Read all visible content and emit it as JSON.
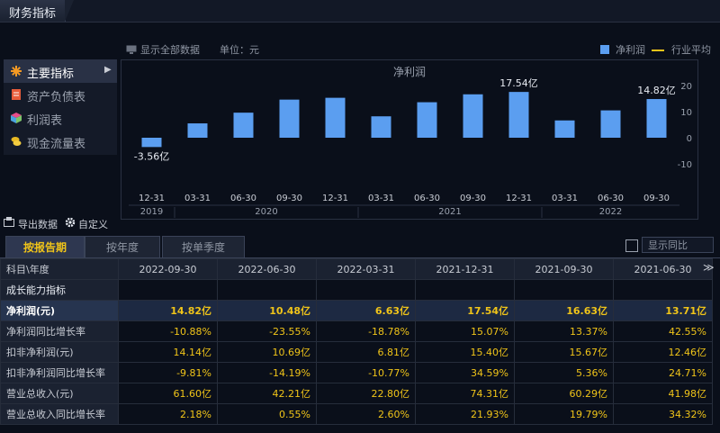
{
  "window": {
    "title": "财务指标"
  },
  "toolbar": {
    "show_all": "显示全部数据",
    "unit": "单位：元",
    "legend_net": "净利润",
    "legend_avg": "行业平均"
  },
  "menu": {
    "items": [
      {
        "label": "主要指标",
        "icon": "asterisk-icon",
        "color": "#f59a23"
      },
      {
        "label": "资产负债表",
        "icon": "document-icon",
        "color": "#e85c3a"
      },
      {
        "label": "利润表",
        "icon": "cube-icon",
        "color": "#4aa3df"
      },
      {
        "label": "现金流量表",
        "icon": "coins-icon",
        "color": "#e8b923"
      }
    ]
  },
  "actions": {
    "export": "导出数据",
    "customize": "自定义"
  },
  "tabs": [
    {
      "label": "按报告期"
    },
    {
      "label": "按年度"
    },
    {
      "label": "按单季度"
    }
  ],
  "yoy_toggle": "显示同比",
  "chart_data": {
    "type": "bar",
    "title": "净利润",
    "unit": "亿",
    "categories": [
      "12-31",
      "03-31",
      "06-30",
      "09-30",
      "12-31",
      "03-31",
      "06-30",
      "09-30",
      "12-31",
      "03-31",
      "06-30",
      "09-30"
    ],
    "years": [
      {
        "label": "2019",
        "from": 0,
        "to": 0
      },
      {
        "label": "2020",
        "from": 1,
        "to": 4
      },
      {
        "label": "2021",
        "from": 5,
        "to": 8
      },
      {
        "label": "2022",
        "from": 9,
        "to": 11
      }
    ],
    "values": [
      -3.56,
      5.5,
      9.6,
      14.6,
      15.3,
      8.2,
      13.6,
      16.63,
      17.54,
      6.63,
      10.48,
      14.82
    ],
    "data_labels": [
      {
        "index": 0,
        "text": "-3.56亿"
      },
      {
        "index": 8,
        "text": "17.54亿"
      },
      {
        "index": 11,
        "text": "14.82亿"
      }
    ],
    "y_ticks": [
      20,
      10,
      0,
      -10
    ],
    "ylim": [
      -15,
      22
    ],
    "bar_color": "#5b9ef0"
  },
  "table": {
    "header_label": "科目\\年度",
    "dates": [
      "2022-09-30",
      "2022-06-30",
      "2022-03-31",
      "2021-12-31",
      "2021-09-30",
      "2021-06-30"
    ],
    "section": "成长能力指标",
    "rows": [
      {
        "label": "净利润(元)",
        "values": [
          "14.82亿",
          "10.48亿",
          "6.63亿",
          "17.54亿",
          "16.63亿",
          "13.71亿"
        ]
      },
      {
        "label": "净利润同比增长率",
        "values": [
          "-10.88%",
          "-23.55%",
          "-18.78%",
          "15.07%",
          "13.37%",
          "42.55%"
        ]
      },
      {
        "label": "扣非净利润(元)",
        "values": [
          "14.14亿",
          "10.69亿",
          "6.81亿",
          "15.40亿",
          "15.67亿",
          "12.46亿"
        ]
      },
      {
        "label": "扣非净利润同比增长率",
        "values": [
          "-9.81%",
          "-14.19%",
          "-10.77%",
          "34.59%",
          "5.36%",
          "24.71%"
        ]
      },
      {
        "label": "营业总收入(元)",
        "values": [
          "61.60亿",
          "42.21亿",
          "22.80亿",
          "74.31亿",
          "60.29亿",
          "41.98亿"
        ]
      },
      {
        "label": "营业总收入同比增长率",
        "values": [
          "2.18%",
          "0.55%",
          "2.60%",
          "21.93%",
          "19.79%",
          "34.32%"
        ]
      }
    ]
  }
}
